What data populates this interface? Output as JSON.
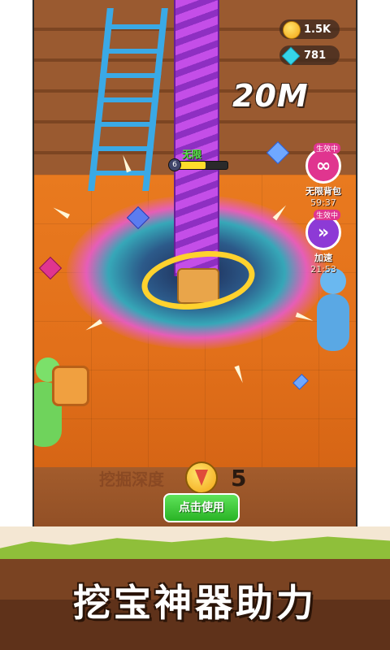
{
  "hud": {
    "coins": "1.5K",
    "gems": "781",
    "depth": "20M"
  },
  "drill_bar": {
    "label": "无限",
    "level": "6",
    "fill": 0.55
  },
  "boosts": [
    {
      "status": "生效中",
      "name": "无限背包",
      "timer": "59:37",
      "icon": "infinity-icon",
      "color": "#e0358f"
    },
    {
      "status": "生效中",
      "name": "加速",
      "timer": "21:53",
      "icon": "speed-icon",
      "color": "#8d3ad6"
    }
  ],
  "bottom": {
    "depth_hint": "挖掘深度",
    "drill_count": "5",
    "use_button": "点击使用"
  },
  "slogan": "挖宝神器助力",
  "colors": {
    "drill": "#c44ee8",
    "floor": "#e97a1f",
    "ladder": "#3aa9e6",
    "button": "#29b325"
  }
}
